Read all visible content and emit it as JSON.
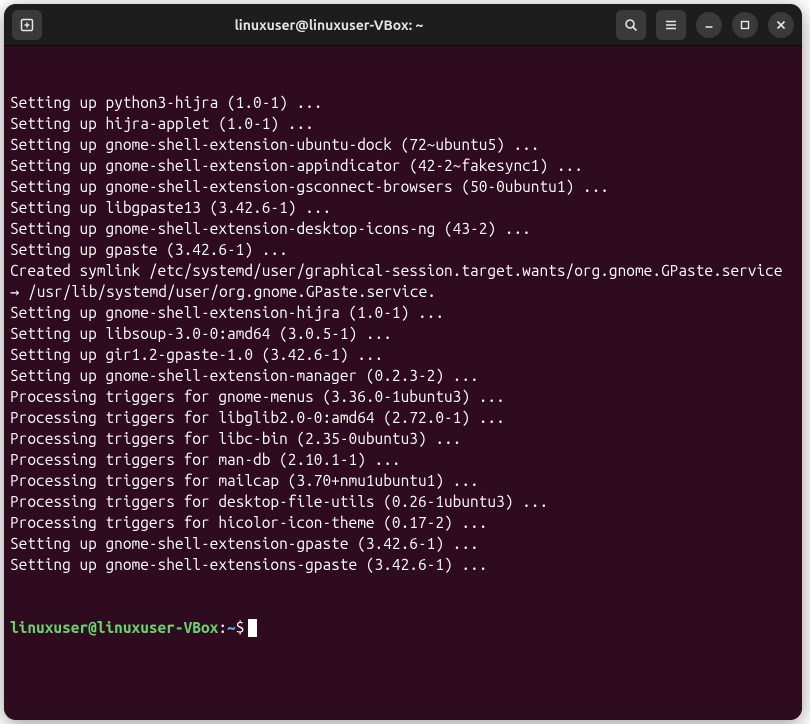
{
  "titlebar": {
    "title": "linuxuser@linuxuser-VBox: ~"
  },
  "terminal": {
    "lines": [
      "Setting up python3-hijra (1.0-1) ...",
      "Setting up hijra-applet (1.0-1) ...",
      "Setting up gnome-shell-extension-ubuntu-dock (72~ubuntu5) ...",
      "Setting up gnome-shell-extension-appindicator (42-2~fakesync1) ...",
      "Setting up gnome-shell-extension-gsconnect-browsers (50-0ubuntu1) ...",
      "Setting up libgpaste13 (3.42.6-1) ...",
      "Setting up gnome-shell-extension-desktop-icons-ng (43-2) ...",
      "Setting up gpaste (3.42.6-1) ...",
      "Created symlink /etc/systemd/user/graphical-session.target.wants/org.gnome.GPaste.service → /usr/lib/systemd/user/org.gnome.GPaste.service.",
      "Setting up gnome-shell-extension-hijra (1.0-1) ...",
      "Setting up libsoup-3.0-0:amd64 (3.0.5-1) ...",
      "Setting up gir1.2-gpaste-1.0 (3.42.6-1) ...",
      "Setting up gnome-shell-extension-manager (0.2.3-2) ...",
      "Processing triggers for gnome-menus (3.36.0-1ubuntu3) ...",
      "Processing triggers for libglib2.0-0:amd64 (2.72.0-1) ...",
      "Processing triggers for libc-bin (2.35-0ubuntu3) ...",
      "Processing triggers for man-db (2.10.1-1) ...",
      "Processing triggers for mailcap (3.70+nmu1ubuntu1) ...",
      "Processing triggers for desktop-file-utils (0.26-1ubuntu3) ...",
      "Processing triggers for hicolor-icon-theme (0.17-2) ...",
      "Setting up gnome-shell-extension-gpaste (3.42.6-1) ...",
      "Setting up gnome-shell-extensions-gpaste (3.42.6-1) ..."
    ],
    "prompt": {
      "userhost": "linuxuser@linuxuser-VBox",
      "colon": ":",
      "path": "~",
      "dollar": "$"
    }
  }
}
